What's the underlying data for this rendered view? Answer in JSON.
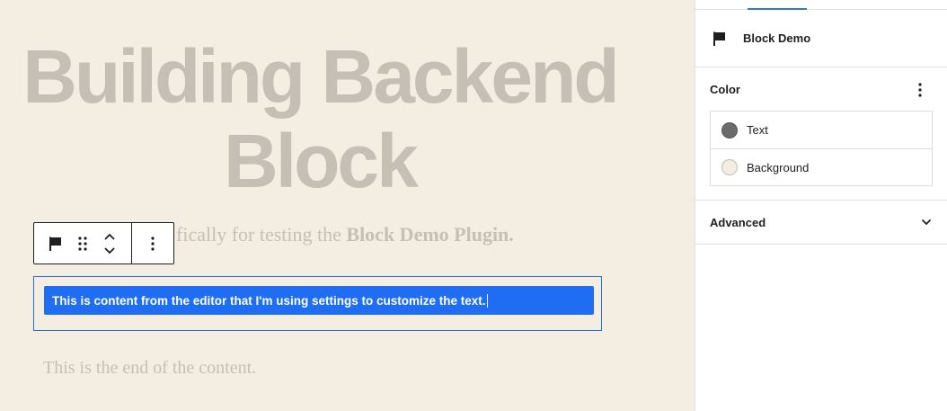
{
  "canvas": {
    "title": "Building Backend Block",
    "intro_prefix": "fically for testing the ",
    "intro_bold": "Block Demo Plugin.",
    "selected_block_text": "This is content from the editor that I'm using settings to customize the text.",
    "outro": "This is the end of the content."
  },
  "toolbar": {
    "icons": [
      "flag-icon",
      "drag-handle-icon",
      "move-up-icon",
      "move-down-icon",
      "more-options-icon"
    ]
  },
  "sidebar": {
    "block_card": {
      "icon": "flag-icon",
      "title": "Block Demo"
    },
    "color_panel": {
      "title": "Color",
      "items": [
        {
          "label": "Text",
          "swatch": "#6b6b6b"
        },
        {
          "label": "Background",
          "swatch": "#f4ede1"
        }
      ]
    },
    "advanced_panel": {
      "title": "Advanced"
    }
  },
  "colors": {
    "canvas_bg": "#f4ede1",
    "faded_text": "#c4c0b6",
    "accent": "#1f6df2",
    "tab_indicator": "#2f7fb6"
  }
}
